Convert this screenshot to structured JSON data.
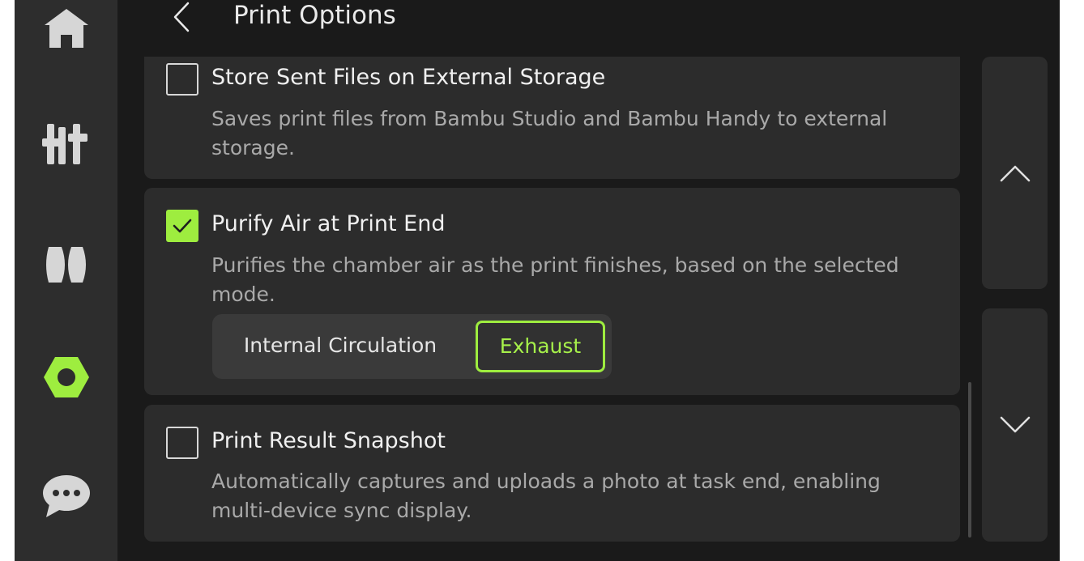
{
  "colors": {
    "accent": "#9eed3f",
    "background": "#1a1a1a",
    "sidebar": "#2d2d2d",
    "card": "#2c2c2c",
    "text_primary": "#f0f0f0",
    "text_secondary": "#a9a9a9"
  },
  "sidebar": {
    "items": [
      {
        "icon": "home-icon",
        "active": false
      },
      {
        "icon": "controls-icon",
        "active": false
      },
      {
        "icon": "filament-icon",
        "active": false
      },
      {
        "icon": "settings-nut-icon",
        "active": true
      },
      {
        "icon": "messages-icon",
        "active": false
      }
    ]
  },
  "header": {
    "back_icon": "chevron-left-icon",
    "title": "Print Options"
  },
  "options": [
    {
      "title": "Store Sent Files on External Storage",
      "description": "Saves print files from Bambu Studio and Bambu Handy to external storage.",
      "checked": false
    },
    {
      "title": "Purify Air at Print End",
      "description": "Purifies the chamber air as the print finishes, based on the selected mode.",
      "checked": true,
      "modes": [
        "Internal Circulation",
        "Exhaust"
      ],
      "selected_mode": "Exhaust"
    },
    {
      "title": "Print Result Snapshot",
      "description": "Automatically captures and uploads a photo at task end, enabling multi-device sync display.",
      "checked": false
    }
  ],
  "pager": {
    "up_icon": "chevron-up-icon",
    "down_icon": "chevron-down-icon"
  }
}
